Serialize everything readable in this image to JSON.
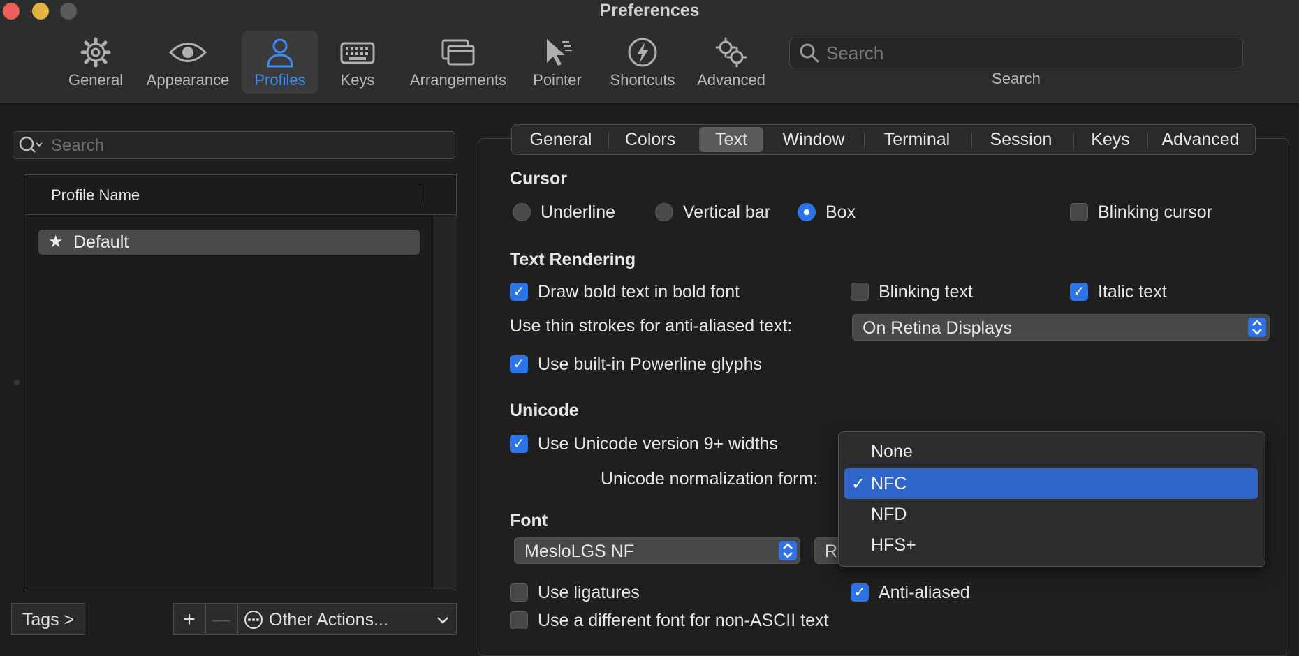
{
  "window": {
    "title": "Preferences"
  },
  "toolbar": {
    "items": [
      {
        "label": "General",
        "icon": "gear-icon"
      },
      {
        "label": "Appearance",
        "icon": "eye-icon"
      },
      {
        "label": "Profiles",
        "icon": "person-icon"
      },
      {
        "label": "Keys",
        "icon": "keyboard-icon"
      },
      {
        "label": "Arrangements",
        "icon": "windows-icon"
      },
      {
        "label": "Pointer",
        "icon": "pointer-icon"
      },
      {
        "label": "Shortcuts",
        "icon": "bolt-icon"
      },
      {
        "label": "Advanced",
        "icon": "gears-icon"
      }
    ],
    "selected": "Profiles",
    "search_placeholder": "Search",
    "search_label": "Search"
  },
  "profiles": {
    "search_placeholder": "Search",
    "column_header": "Profile Name",
    "items": [
      {
        "name": "Default",
        "star": "★"
      }
    ],
    "tags_button": "Tags >",
    "add_button": "+",
    "remove_button": "—",
    "other_actions": "Other Actions..."
  },
  "tabs": {
    "items": [
      "General",
      "Colors",
      "Text",
      "Window",
      "Terminal",
      "Session",
      "Keys",
      "Advanced"
    ],
    "selected": "Text"
  },
  "cursor": {
    "title": "Cursor",
    "underline": "Underline",
    "vertical_bar": "Vertical bar",
    "box": "Box",
    "selected": "Box",
    "blinking": {
      "label": "Blinking cursor",
      "checked": false
    }
  },
  "rendering": {
    "title": "Text Rendering",
    "bold": {
      "label": "Draw bold text in bold font",
      "checked": true
    },
    "blinking_text": {
      "label": "Blinking text",
      "checked": false
    },
    "italic": {
      "label": "Italic text",
      "checked": true
    },
    "thin_strokes_label": "Use thin strokes for anti-aliased text:",
    "thin_strokes_value": "On Retina Displays",
    "powerline": {
      "label": "Use built-in Powerline glyphs",
      "checked": true
    }
  },
  "unicode": {
    "title": "Unicode",
    "widths": {
      "label": "Use Unicode version 9+ widths",
      "checked": true
    },
    "normalization_label": "Unicode normalization form:",
    "menu_options": [
      "None",
      "NFC",
      "NFD",
      "HFS+"
    ],
    "selected": "NFC",
    "check": "✓"
  },
  "font": {
    "title": "Font",
    "family": "MesloLGS NF",
    "style_partial": "R",
    "ligatures": {
      "label": "Use ligatures",
      "checked": false
    },
    "antialiased": {
      "label": "Anti-aliased",
      "checked": true
    },
    "non_ascii": {
      "label": "Use a different font for non-ASCII text",
      "checked": false
    }
  },
  "colors": {
    "accent": "#2f74e6",
    "selection": "#2f65c9",
    "close": "#ec5f57",
    "minimize": "#e3b341"
  }
}
